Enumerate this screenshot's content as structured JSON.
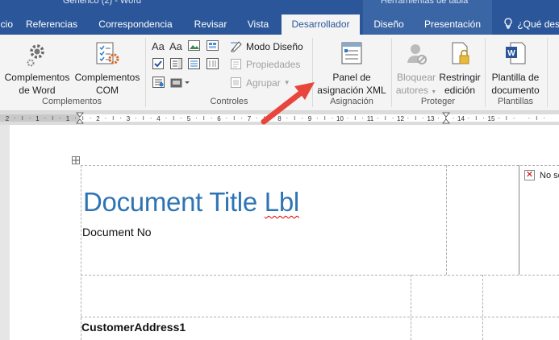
{
  "window": {
    "title": "Genérico (2) - Word",
    "context_title": "Herramientas de tabla"
  },
  "tabs": [
    {
      "label": "Inicio"
    },
    {
      "label": "Referencias"
    },
    {
      "label": "Correspondencia"
    },
    {
      "label": "Revisar"
    },
    {
      "label": "Vista"
    },
    {
      "label": "Desarrollador"
    },
    {
      "label": "Diseño"
    },
    {
      "label": "Presentación"
    }
  ],
  "help": {
    "label": "¿Qué dese"
  },
  "ribbon": {
    "complementos": {
      "word_line1": "Complementos",
      "word_line2": "de Word",
      "com_line1": "Complementos",
      "com_line2": "COM",
      "group": "Complementos"
    },
    "controles": {
      "design_mode": "Modo Diseño",
      "properties": "Propiedades",
      "group_btn": "Agrupar",
      "group": "Controles"
    },
    "asignacion": {
      "line1": "Panel de",
      "line2": "asignación XML",
      "group": "Asignación"
    },
    "proteger": {
      "block_line1": "Bloquear",
      "block_line2": "autores",
      "restrict_line1": "Restringir",
      "restrict_line2": "edición",
      "group": "Proteger"
    },
    "plantillas": {
      "line1": "Plantilla de",
      "line2": "documento",
      "group": "Plantillas"
    }
  },
  "ruler": {
    "marks": [
      "2",
      "1",
      "1",
      "2",
      "3",
      "4",
      "5",
      "6",
      "7",
      "8",
      "9",
      "10",
      "11",
      "12",
      "13",
      "14",
      "15"
    ]
  },
  "document": {
    "title_part1": "Document Title",
    "title_part2": "Lbl",
    "doc_no": "Document No",
    "customer_address": "CustomerAddress1",
    "no_selection": "No se"
  },
  "colors": {
    "brand": "#2b579a",
    "title_text": "#2e74b5",
    "arrow": "#e8453c"
  }
}
